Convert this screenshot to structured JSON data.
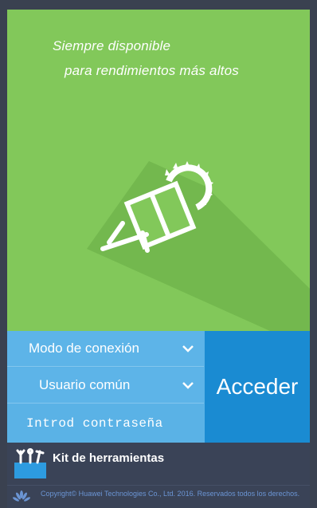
{
  "hero": {
    "tagline_line1": "Siempre disponible",
    "tagline_line2": "para rendimientos más altos",
    "background_color": "#82c85a",
    "icon": "solar-panel-sun-icon"
  },
  "login": {
    "connection_mode_label": "Modo de conexión",
    "user_type_label": "Usuario común",
    "password_placeholder": "Introd contraseña",
    "password_value": "",
    "submit_label": "Acceder",
    "field_color": "#5ab2e6",
    "submit_color": "#1a8bd2"
  },
  "toolkit": {
    "label": "Kit de herramientas",
    "icon": "toolkit-icon"
  },
  "footer": {
    "copyright": "Copyright© Huawei Technologies Co., Ltd. 2016. Reservados todos los derechos.",
    "logo": "huawei-logo"
  }
}
